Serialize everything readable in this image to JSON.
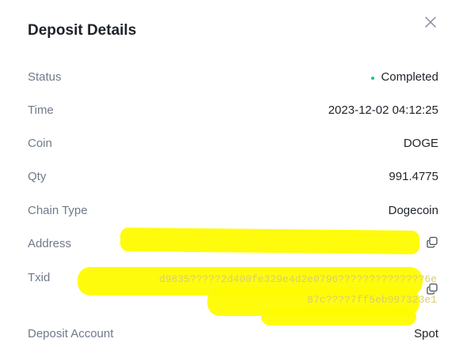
{
  "title": "Deposit Details",
  "rows": [
    {
      "label": "Status",
      "value": "Completed"
    },
    {
      "label": "Time",
      "value": "2023-12-02 04:12:25"
    },
    {
      "label": "Coin",
      "value": "DOGE"
    },
    {
      "label": "Qty",
      "value": "991.4775"
    },
    {
      "label": "Chain Type",
      "value": "Dogecoin"
    },
    {
      "label": "Address",
      "value": ""
    },
    {
      "label": "Txid",
      "value_line1": "d9835?????2d400fe329e4d2e0796??????????????6e",
      "value_line2": "87c????7ff5eb997323e1"
    },
    {
      "label": "Deposit Account",
      "value": "Spot"
    }
  ],
  "colors": {
    "status_dot": "#0ecb81",
    "highlight": "#fffb00"
  },
  "icons": {
    "close": "close-icon",
    "copy": "copy-icon"
  }
}
